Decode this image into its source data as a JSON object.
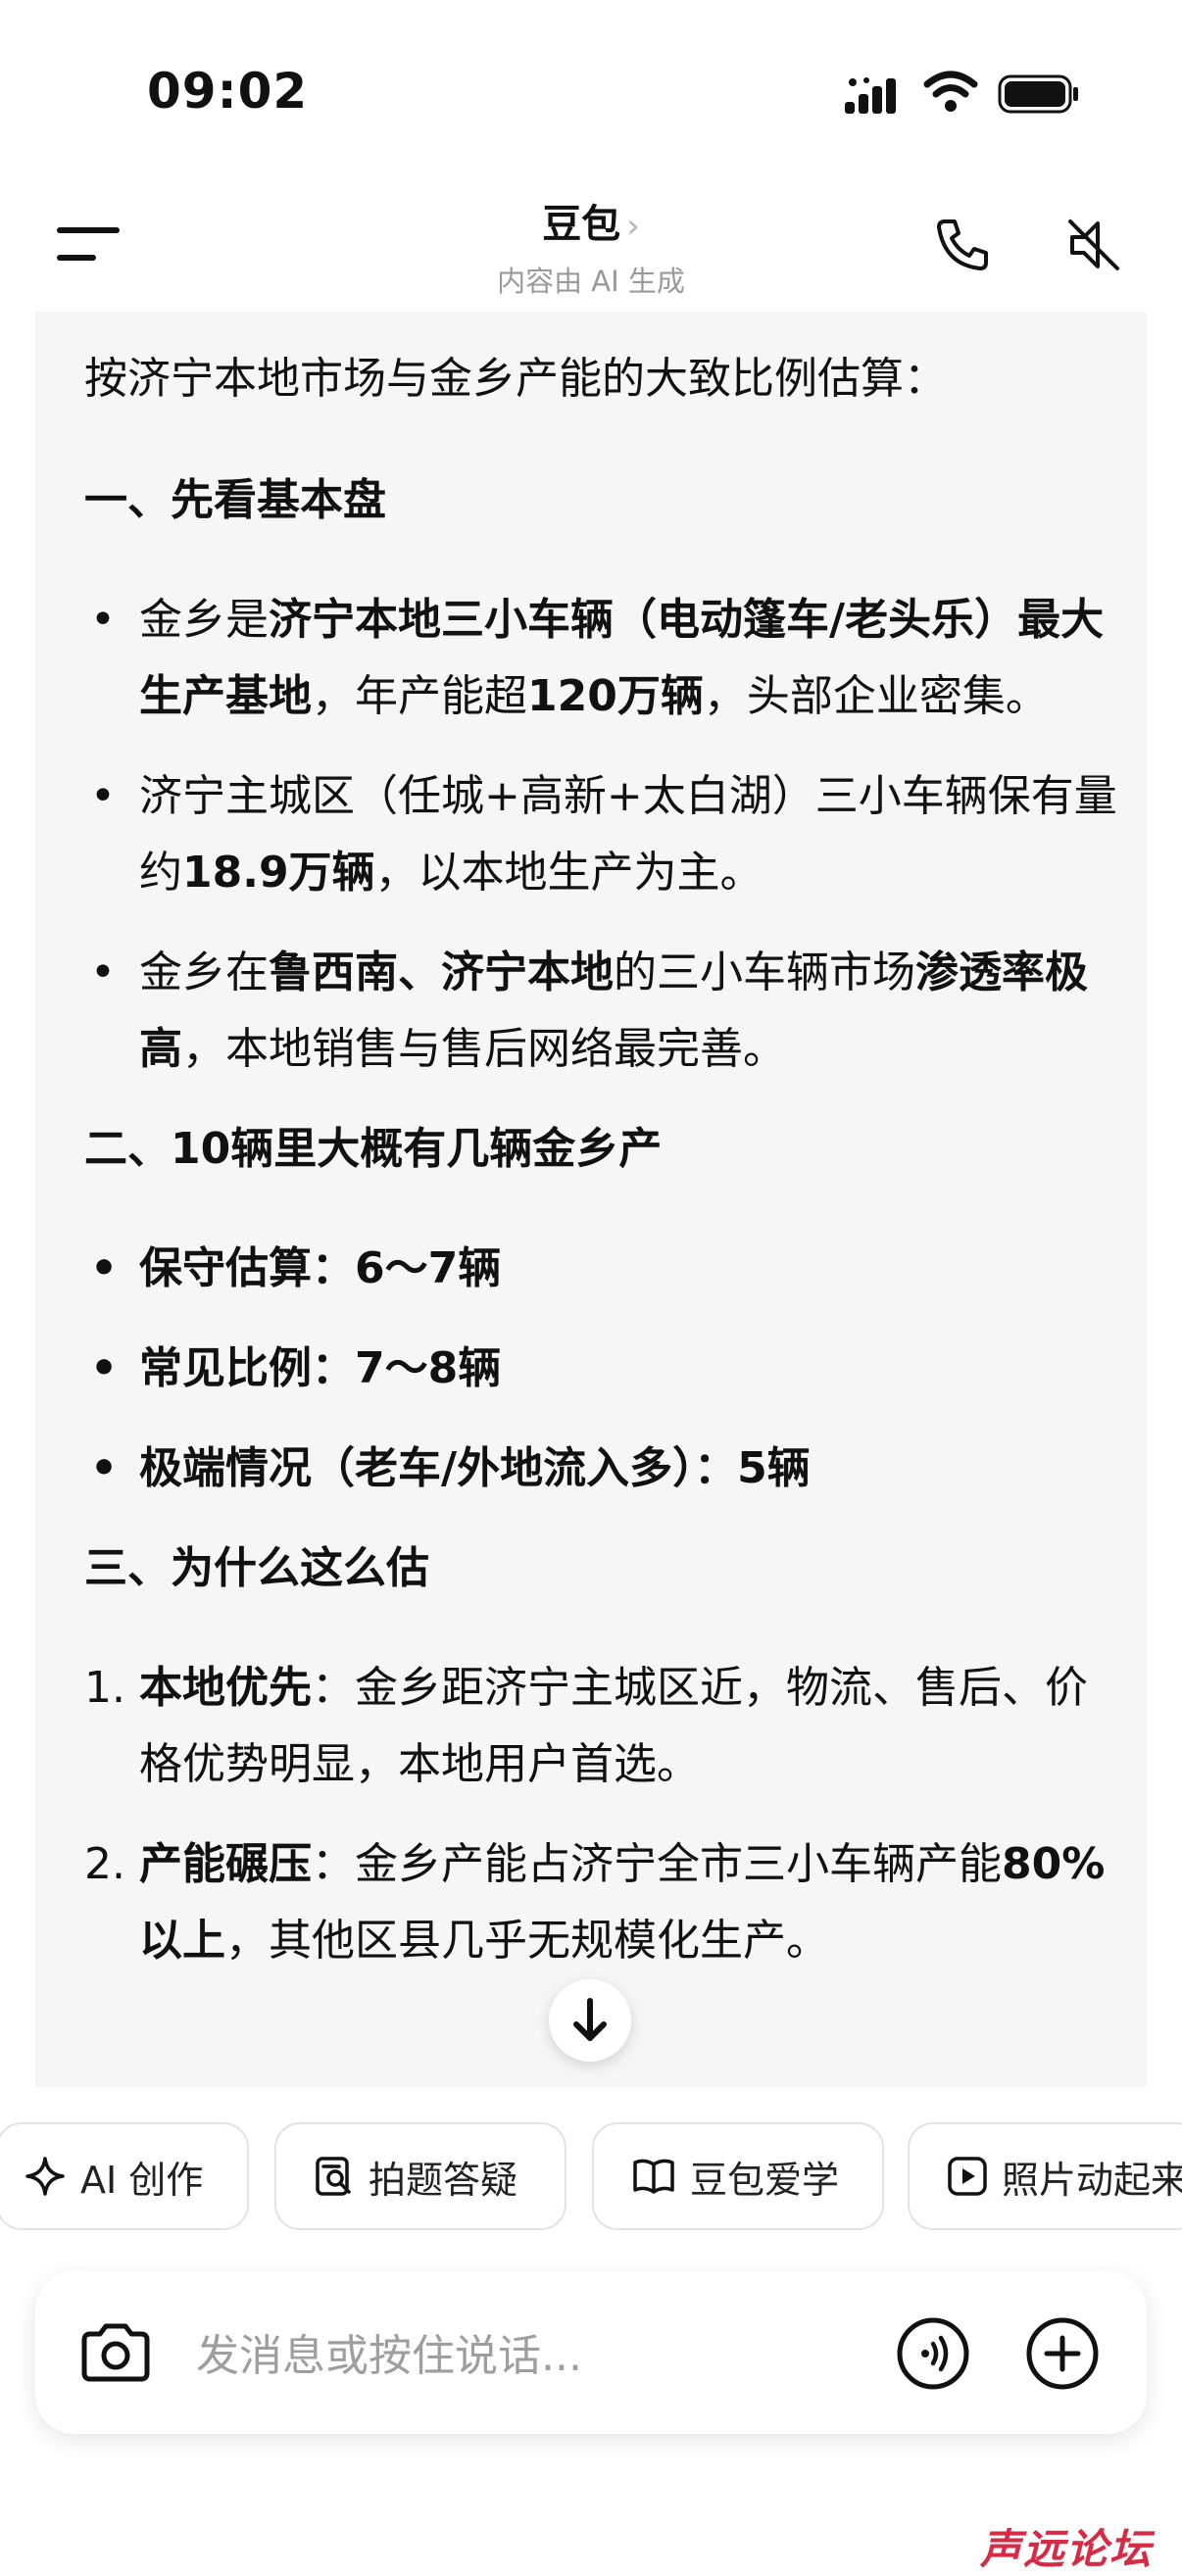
{
  "status_bar": {
    "time": "09:02"
  },
  "header": {
    "title": "豆包",
    "title_chevron": "›",
    "subtitle": "内容由 AI 生成"
  },
  "message": {
    "intro": "按济宁本地市场与金乡产能的大致比例估算：",
    "section1": {
      "heading": "一、先看基本盘",
      "items": [
        {
          "p1": "金乡是",
          "b1": "济宁本地三小车辆（电动篷车/老头乐）最大生产基地",
          "p2": "，年产能超",
          "b2": "120万辆",
          "p3": "，头部企业密集。"
        },
        {
          "p1": "济宁主城区（任城+高新+太白湖）三小车辆保有量约",
          "b1": "18.9万辆",
          "p2": "，以本地生产为主。"
        },
        {
          "p1": "金乡在",
          "b1": "鲁西南、济宁本地",
          "p2": "的三小车辆市场",
          "b2": "渗透率极高",
          "p3": "，本地销售与售后网络最完善。"
        }
      ]
    },
    "section2": {
      "heading": "二、10辆里大概有几辆金乡产",
      "items": [
        "保守估算：6～7辆",
        "常见比例：7～8辆",
        "极端情况（老车/外地流入多）：5辆"
      ]
    },
    "section3": {
      "heading": "三、为什么这么估",
      "items": [
        {
          "num": "1.",
          "b1": "本地优先",
          "p1": "：金乡距济宁主城区近，物流、售后、价格优势明显，本地用户首选。"
        },
        {
          "num": "2.",
          "b1": "产能碾压",
          "p1": "：金乡产能占济宁全市三小车辆产能",
          "b2": "80%以上",
          "p2": "，其他区县几乎无规模化生产。"
        }
      ]
    }
  },
  "chips": [
    {
      "label": "AI 创作",
      "icon": "sparkle-icon"
    },
    {
      "label": "拍题答疑",
      "icon": "photo-search-icon"
    },
    {
      "label": "豆包爱学",
      "icon": "book-icon"
    },
    {
      "label": "照片动起来",
      "icon": "play-icon"
    }
  ],
  "input": {
    "placeholder": "发消息或按住说话..."
  },
  "watermark": "声远论坛"
}
